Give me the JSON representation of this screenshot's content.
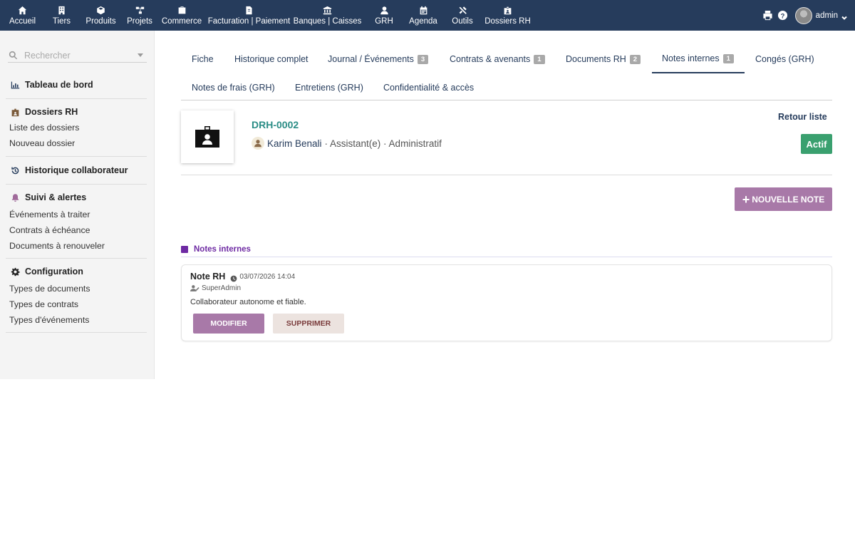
{
  "topnav": {
    "items": [
      {
        "label": "Accueil",
        "icon": "home-icon"
      },
      {
        "label": "Tiers",
        "icon": "building-icon"
      },
      {
        "label": "Produits",
        "icon": "cube-icon"
      },
      {
        "label": "Projets",
        "icon": "project-icon"
      },
      {
        "label": "Commerce",
        "icon": "briefcase-icon"
      },
      {
        "label": "Facturation | Paiement",
        "icon": "invoice-icon"
      },
      {
        "label": "Banques | Caisses",
        "icon": "bank-icon"
      },
      {
        "label": "GRH",
        "icon": "user-icon"
      },
      {
        "label": "Agenda",
        "icon": "calendar-icon"
      },
      {
        "label": "Outils",
        "icon": "tools-icon"
      },
      {
        "label": "Dossiers RH",
        "icon": "id-badge-icon"
      }
    ],
    "username": "admin"
  },
  "sidebar": {
    "search_placeholder": "Rechercher",
    "dashboard": "Tableau de bord",
    "dossiers": {
      "title": "Dossiers RH",
      "links": [
        "Liste des dossiers",
        "Nouveau dossier"
      ]
    },
    "historique": "Historique collaborateur",
    "suivi": {
      "title": "Suivi & alertes",
      "links": [
        "Événements à traiter",
        "Contrats à échéance",
        "Documents à renouveler"
      ]
    },
    "configuration": {
      "title": "Configuration",
      "links": [
        "Types de documents",
        "Types de contrats",
        "Types d'événements"
      ]
    }
  },
  "tabs": {
    "fiche": "Fiche",
    "historique": "Historique complet",
    "journal": {
      "label": "Journal / Événements",
      "badge": "3"
    },
    "contrats": {
      "label": "Contrats & avenants",
      "badge": "1"
    },
    "documents": {
      "label": "Documents RH",
      "badge": "2"
    },
    "notes": {
      "label": "Notes internes",
      "badge": "1"
    },
    "conges": "Congés (GRH)",
    "frais": "Notes de frais (GRH)",
    "entretiens": "Entretiens (GRH)",
    "confidentialite": "Confidentialité & accès"
  },
  "header": {
    "ref": "DRH-0002",
    "name": "Karim Benali",
    "subtitle": "· Assistant(e) · Administratif",
    "back": "Retour liste",
    "status": "Actif"
  },
  "actions": {
    "new_note": "NOUVELLE NOTE"
  },
  "section": {
    "title": "Notes internes"
  },
  "note": {
    "title": "Note RH",
    "date": "03/07/2026 14:04",
    "author": "SuperAdmin",
    "body": "Collaborateur autonome et fiable.",
    "edit": "MODIFIER",
    "delete": "SUPPRIMER"
  },
  "colors": {
    "topbar": "#263c5c",
    "accent_teal": "#2b8d86",
    "status_green": "#3aa06f",
    "button_purple": "#a879a8",
    "section_purple": "#6e2aa3"
  }
}
